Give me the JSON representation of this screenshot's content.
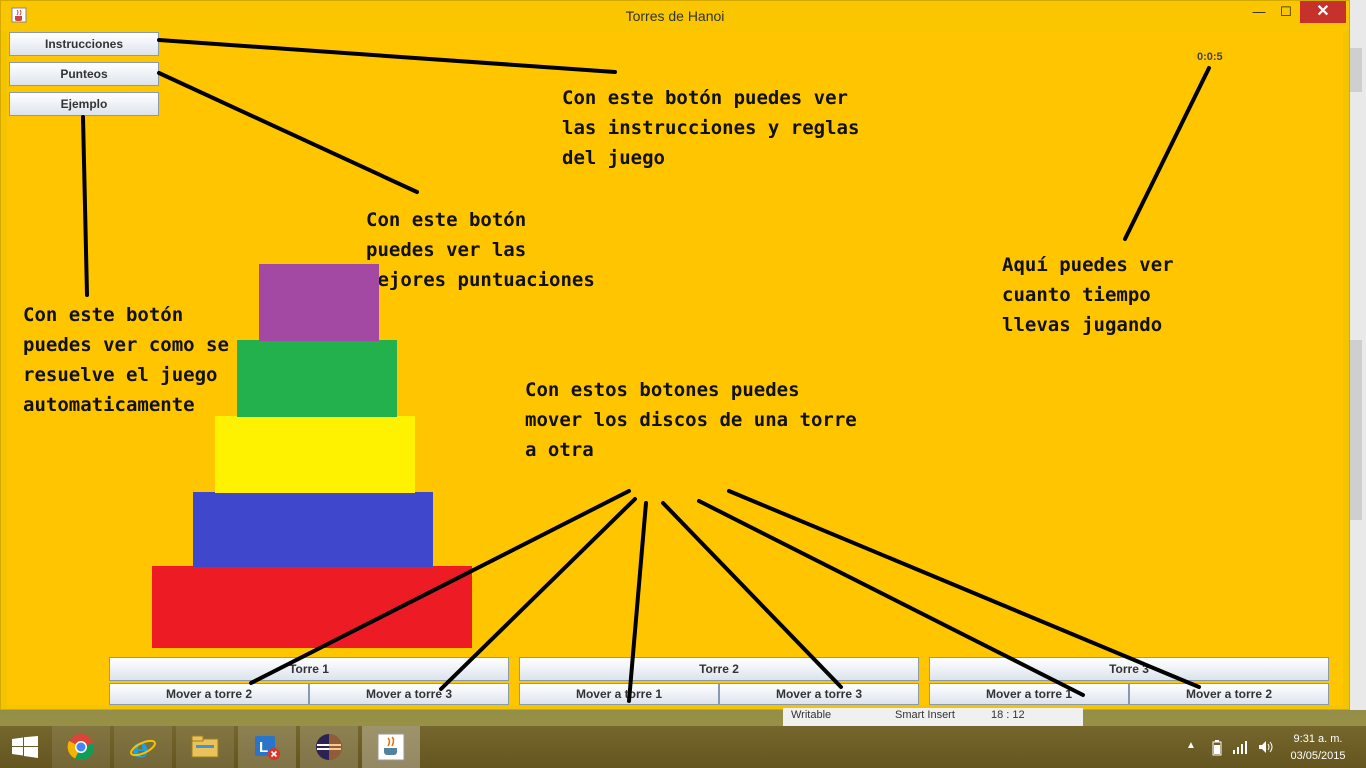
{
  "window": {
    "title": "Torres de Hanoi",
    "close_glyph": "✕",
    "minimize_glyph": "—",
    "maximize_glyph": "☐"
  },
  "menu_buttons": {
    "instrucciones": "Instrucciones",
    "punteos": "Punteos",
    "ejemplo": "Ejemplo"
  },
  "timer": "0:0:5",
  "notes": {
    "instrucciones": "Con este botón puedes ver\nlas instrucciones y reglas\ndel juego",
    "punteos": "Con este botón\npuedes ver las\nmejores puntuaciones",
    "ejemplo": "Con este botón\npuedes ver como se\nresuelve el juego\nautomaticamente",
    "tiempo": "Aquí puedes ver\ncuanto tiempo\nllevas jugando",
    "mover": "Con estos botones puedes\nmover los discos de una torre\na otra"
  },
  "disks": [
    {
      "id": 1,
      "color": "#a349a4"
    },
    {
      "id": 2,
      "color": "#22b14c"
    },
    {
      "id": 3,
      "color": "#fff200"
    },
    {
      "id": 4,
      "color": "#3f48cc"
    },
    {
      "id": 5,
      "color": "#ed1c24"
    }
  ],
  "towers": [
    {
      "title": "Torre 1",
      "buttons": [
        "Mover a torre 2",
        "Mover a torre 3"
      ]
    },
    {
      "title": "Torre 2",
      "buttons": [
        "Mover a torre 1",
        "Mover a torre 3"
      ]
    },
    {
      "title": "Torre 3",
      "buttons": [
        "Mover a torre 1",
        "Mover a torre 2"
      ]
    }
  ],
  "status_bar": {
    "mode": "Writable",
    "insert": "Smart Insert",
    "position": "18 : 12"
  },
  "taskbar": {
    "apps": [
      "start-icon",
      "chrome-icon",
      "internet-explorer-icon",
      "file-explorer-icon",
      "lync-icon",
      "eclipse-icon",
      "java-icon"
    ],
    "clock_time": "9:31 a. m.",
    "clock_date": "03/05/2015"
  },
  "colors": {
    "background": "#ffc600",
    "close_button": "#c7312b"
  }
}
